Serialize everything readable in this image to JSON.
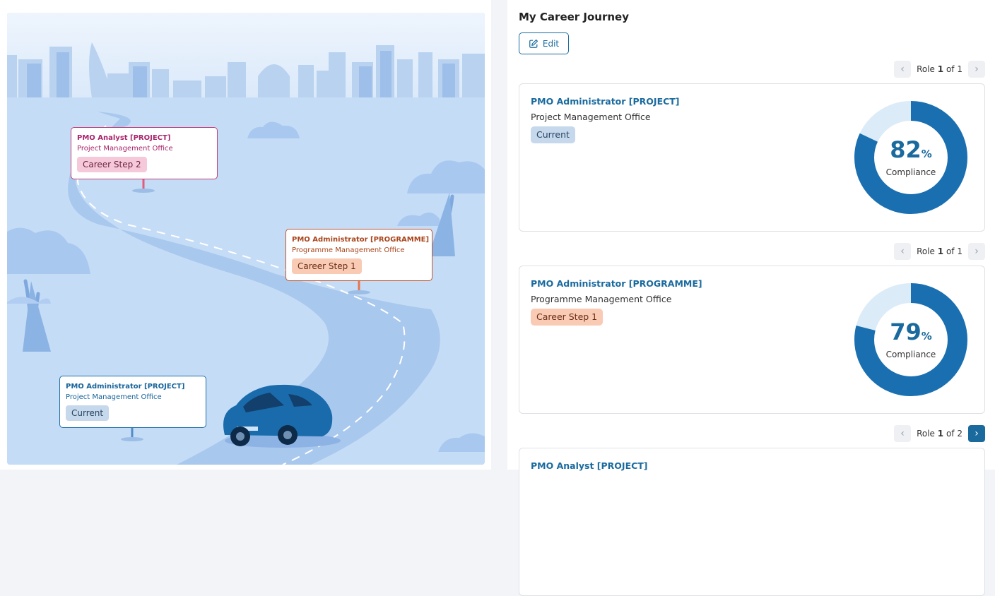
{
  "map": {
    "cards": [
      {
        "title": "PMO Analyst [PROJECT]",
        "subtitle": "Project Management Office",
        "badge": "Career Step 2"
      },
      {
        "title": "PMO Administrator [PROGRAMME]",
        "subtitle": "Programme Management Office",
        "badge": "Career Step 1"
      },
      {
        "title": "PMO Administrator [PROJECT]",
        "subtitle": "Project Management Office",
        "badge": "Current"
      }
    ],
    "colors": {
      "sky": "#e6f0fc",
      "ground": "#c5dcf6",
      "road": "#a7c6ee",
      "car": "#1a6bab"
    }
  },
  "journey": {
    "title": "My Career Journey",
    "edit_label": "Edit",
    "role_word": "Role",
    "of_word": "of",
    "sections": [
      {
        "pager": {
          "current": "1",
          "total": "1",
          "next_enabled": false
        },
        "card": {
          "title": "PMO Administrator [PROJECT]",
          "subtitle": "Project Management Office",
          "badge": "Current",
          "compliance": 82,
          "percent_symbol": "%",
          "compliance_label": "Compliance"
        }
      },
      {
        "pager": {
          "current": "1",
          "total": "1",
          "next_enabled": false
        },
        "card": {
          "title": "PMO Administrator [PROGRAMME]",
          "subtitle": "Programme Management Office",
          "badge": "Career Step 1",
          "compliance": 79,
          "percent_symbol": "%",
          "compliance_label": "Compliance"
        }
      },
      {
        "pager": {
          "current": "1",
          "total": "2",
          "next_enabled": true
        },
        "card": {
          "title": "PMO Analyst [PROJECT]",
          "subtitle": "",
          "badge": "",
          "compliance": null,
          "percent_symbol": "",
          "compliance_label": ""
        }
      }
    ],
    "colors": {
      "accent": "#1a6a9e",
      "gauge_track": "#dcebf8",
      "gauge_fill": "#1a6fb0"
    }
  }
}
